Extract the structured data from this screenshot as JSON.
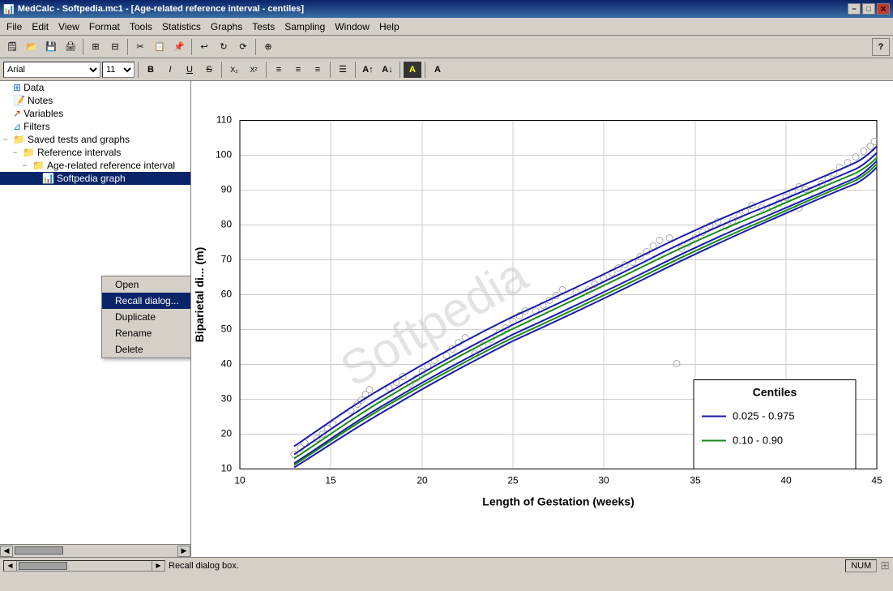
{
  "window": {
    "title": "MedCalc - Softpedia.mc1 - [Age-related reference interval - centiles]",
    "app_icon": "📊"
  },
  "title_controls": {
    "minimize": "−",
    "maximize": "□",
    "close": "✕"
  },
  "menu": {
    "items": [
      "File",
      "Edit",
      "View",
      "Format",
      "Tools",
      "Statistics",
      "Graphs",
      "Tests",
      "Sampling",
      "Window",
      "Help"
    ]
  },
  "format_bar": {
    "font": "Arial",
    "size": "11",
    "bold": "B",
    "italic": "I",
    "underline": "U",
    "strikethrough": "S"
  },
  "sidebar": {
    "items": [
      {
        "id": "data",
        "label": "Data",
        "indent": 0,
        "icon": "grid",
        "expand": ""
      },
      {
        "id": "notes",
        "label": "Notes",
        "indent": 0,
        "icon": "note",
        "expand": ""
      },
      {
        "id": "variables",
        "label": "Variables",
        "indent": 0,
        "icon": "var",
        "expand": ""
      },
      {
        "id": "filters",
        "label": "Filters",
        "indent": 0,
        "icon": "filter",
        "expand": ""
      },
      {
        "id": "saved-tests",
        "label": "Saved tests and graphs",
        "indent": 0,
        "icon": "folder",
        "expand": "−"
      },
      {
        "id": "ref-intervals",
        "label": "Reference intervals",
        "indent": 1,
        "icon": "folder",
        "expand": "−"
      },
      {
        "id": "age-related",
        "label": "Age-related reference interval",
        "indent": 2,
        "icon": "folder",
        "expand": "−"
      },
      {
        "id": "softpedia-graph",
        "label": "Softpedia graph",
        "indent": 3,
        "icon": "chart",
        "expand": "",
        "selected": true
      }
    ]
  },
  "context_menu": {
    "items": [
      "Open",
      "Recall dialog...",
      "Duplicate",
      "Rename",
      "Delete"
    ],
    "highlighted": "Recall dialog..."
  },
  "chart": {
    "title": "",
    "x_label": "Length of Gestation (weeks)",
    "y_label": "Biparietal di... (m)",
    "x_min": 10,
    "x_max": 45,
    "y_min": 10,
    "y_max": 110,
    "x_ticks": [
      10,
      15,
      20,
      25,
      30,
      35,
      40,
      45
    ],
    "y_ticks": [
      10,
      20,
      30,
      40,
      50,
      60,
      70,
      80,
      90,
      100,
      110
    ],
    "watermark": "Softpedia",
    "legend": {
      "title": "Centiles",
      "items": [
        {
          "label": "0.025 - 0.975",
          "color": "#1a1aaa"
        },
        {
          "label": "0.10 - 0.90",
          "color": "#1a8a1a"
        }
      ]
    }
  },
  "status_bar": {
    "text": "Recall dialog box.",
    "num_indicator": "NUM"
  }
}
